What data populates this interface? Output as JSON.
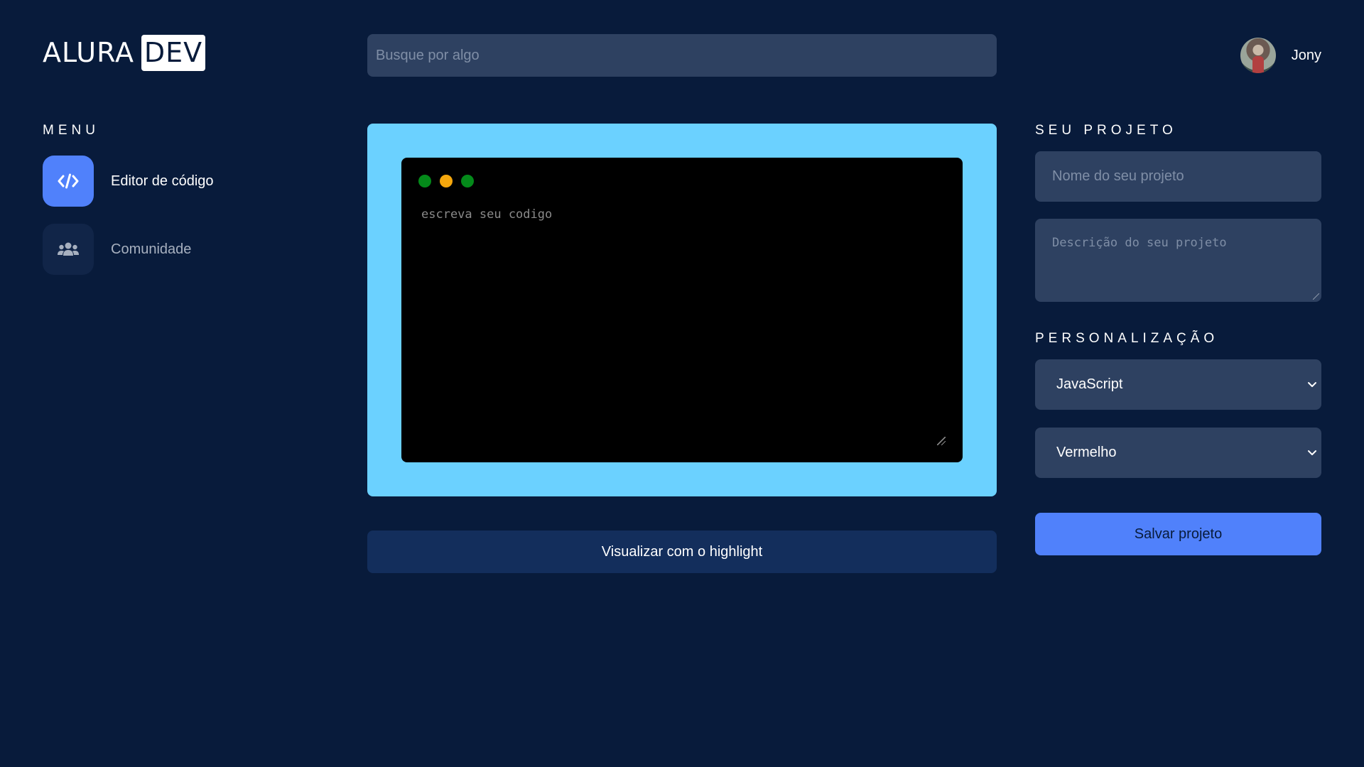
{
  "logo": {
    "word": "ALURA",
    "box": "DEV"
  },
  "search": {
    "placeholder": "Busque por algo",
    "value": ""
  },
  "user": {
    "name": "Jony"
  },
  "menu": {
    "title": "MENU",
    "items": [
      {
        "label": "Editor de código",
        "icon": "code-icon",
        "active": true
      },
      {
        "label": "Comunidade",
        "icon": "users-icon",
        "active": false
      }
    ]
  },
  "editor": {
    "placeholder": "escreva seu codigo",
    "window_dots": [
      "#048a1a",
      "#f5a70d",
      "#048a1a"
    ],
    "frame_color": "#6bd1ff"
  },
  "highlight_button": "Visualizar com o highlight",
  "project": {
    "title": "SEU PROJETO",
    "name_placeholder": "Nome do seu projeto",
    "description_placeholder": "Descrição do seu projeto"
  },
  "customization": {
    "title": "PERSONALIZAÇÃO",
    "language": "JavaScript",
    "color": "Vermelho"
  },
  "save_button": "Salvar projeto",
  "colors": {
    "background": "#081b3b",
    "accent": "#5081fb",
    "field": "#2e4161"
  }
}
